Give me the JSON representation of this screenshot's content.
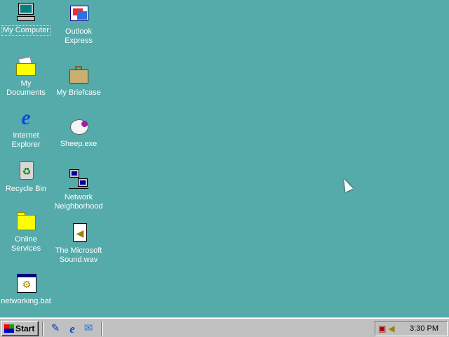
{
  "desktop": {
    "icons": [
      {
        "label": "My Computer",
        "icon": "computer-icon"
      },
      {
        "label": "My Documents",
        "icon": "folder-documents-icon"
      },
      {
        "label": "Internet Explorer",
        "icon": "internet-explorer-icon"
      },
      {
        "label": "Recycle Bin",
        "icon": "recycle-bin-icon"
      },
      {
        "label": "Online Services",
        "icon": "folder-icon"
      },
      {
        "label": "networking.bat",
        "icon": "batch-file-icon"
      },
      {
        "label": "Outlook Express",
        "icon": "outlook-express-icon"
      },
      {
        "label": "My Briefcase",
        "icon": "briefcase-icon"
      },
      {
        "label": "Sheep.exe",
        "icon": "sheep-icon"
      },
      {
        "label": "Network Neighborhood",
        "icon": "network-icon"
      },
      {
        "label": "The Microsoft Sound.wav",
        "icon": "sound-file-icon"
      }
    ]
  },
  "taskbar": {
    "start_label": "Start",
    "clock": "3:30 PM"
  },
  "colors": {
    "desktop": "#55aaaa",
    "taskbar": "#c0c0c0"
  }
}
